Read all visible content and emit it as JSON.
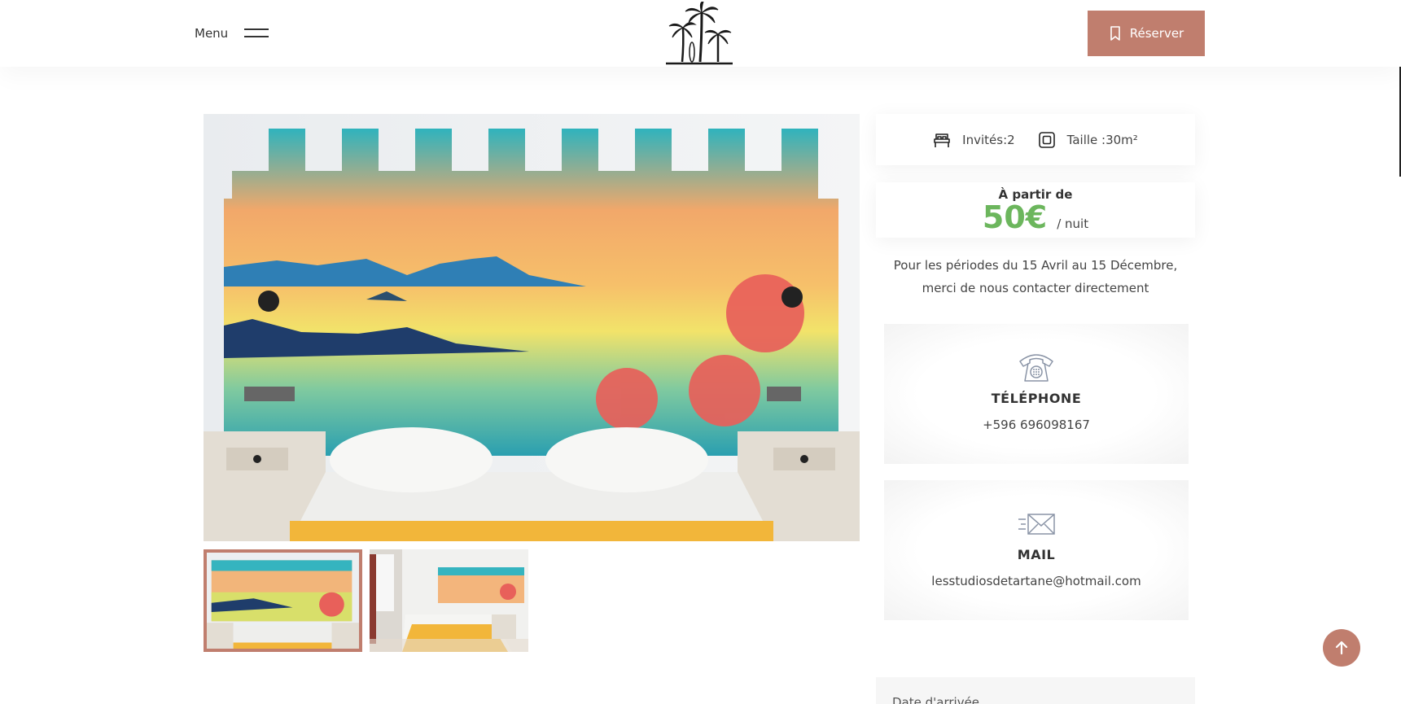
{
  "header": {
    "menu_label": "Menu",
    "reserve_label": "Réserver",
    "accent_color": "#c07e6e"
  },
  "gallery": {
    "main_photo": "room-photo-painted-headboard",
    "thumbnails": [
      "room-photo-painted-headboard",
      "room-photo-wide-view"
    ],
    "active_index": 0
  },
  "room_info": {
    "guests": "Invités:2",
    "size": "Taille :30m²",
    "guests_icon": "bed-icon",
    "size_icon": "square-icon"
  },
  "pricing": {
    "from_label": "À partir de",
    "price": "50€",
    "unit": "/ nuit",
    "price_color": "#6cb65d"
  },
  "period_note": "Pour les périodes du 15 Avril au 15 Décembre, merci de nous contacter directement",
  "contact": {
    "phone_title": "TÉLÉPHONE",
    "phone_value": "+596 696098167",
    "mail_title": "MAIL",
    "mail_value": "lesstudiosdetartane@hotmail.com"
  },
  "booking_form": {
    "arrival_label": "Date d'arrivée"
  }
}
